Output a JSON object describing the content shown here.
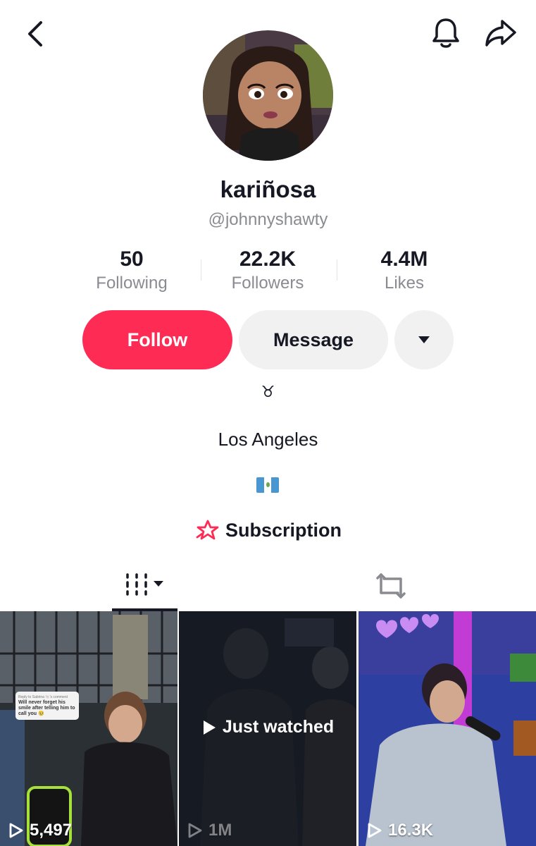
{
  "profile": {
    "display_name": "kariñosa",
    "handle": "@johnnyshawty",
    "avatar_icon": "cartoon-doll-avatar"
  },
  "stats": [
    {
      "value": "50",
      "label": "Following"
    },
    {
      "value": "22.2K",
      "label": "Followers"
    },
    {
      "value": "4.4M",
      "label": "Likes"
    }
  ],
  "actions": {
    "follow_label": "Follow",
    "message_label": "Message"
  },
  "bio": {
    "zodiac": "♉",
    "location": "Los Angeles",
    "flag": "guatemala-flag"
  },
  "subscription": {
    "label": "Subscription"
  },
  "videos": [
    {
      "views": "5,497",
      "caption_reply": "Reply to Sabrina 🐚's comment",
      "caption": "Will never forget his smile after telling him to call you 🥹"
    },
    {
      "views": "1M",
      "overlay": "Just watched"
    },
    {
      "views": "16.3K"
    }
  ],
  "colors": {
    "accent": "#fe2c55",
    "button_gray": "#f1f1f2",
    "muted_text": "#8a8b91"
  }
}
